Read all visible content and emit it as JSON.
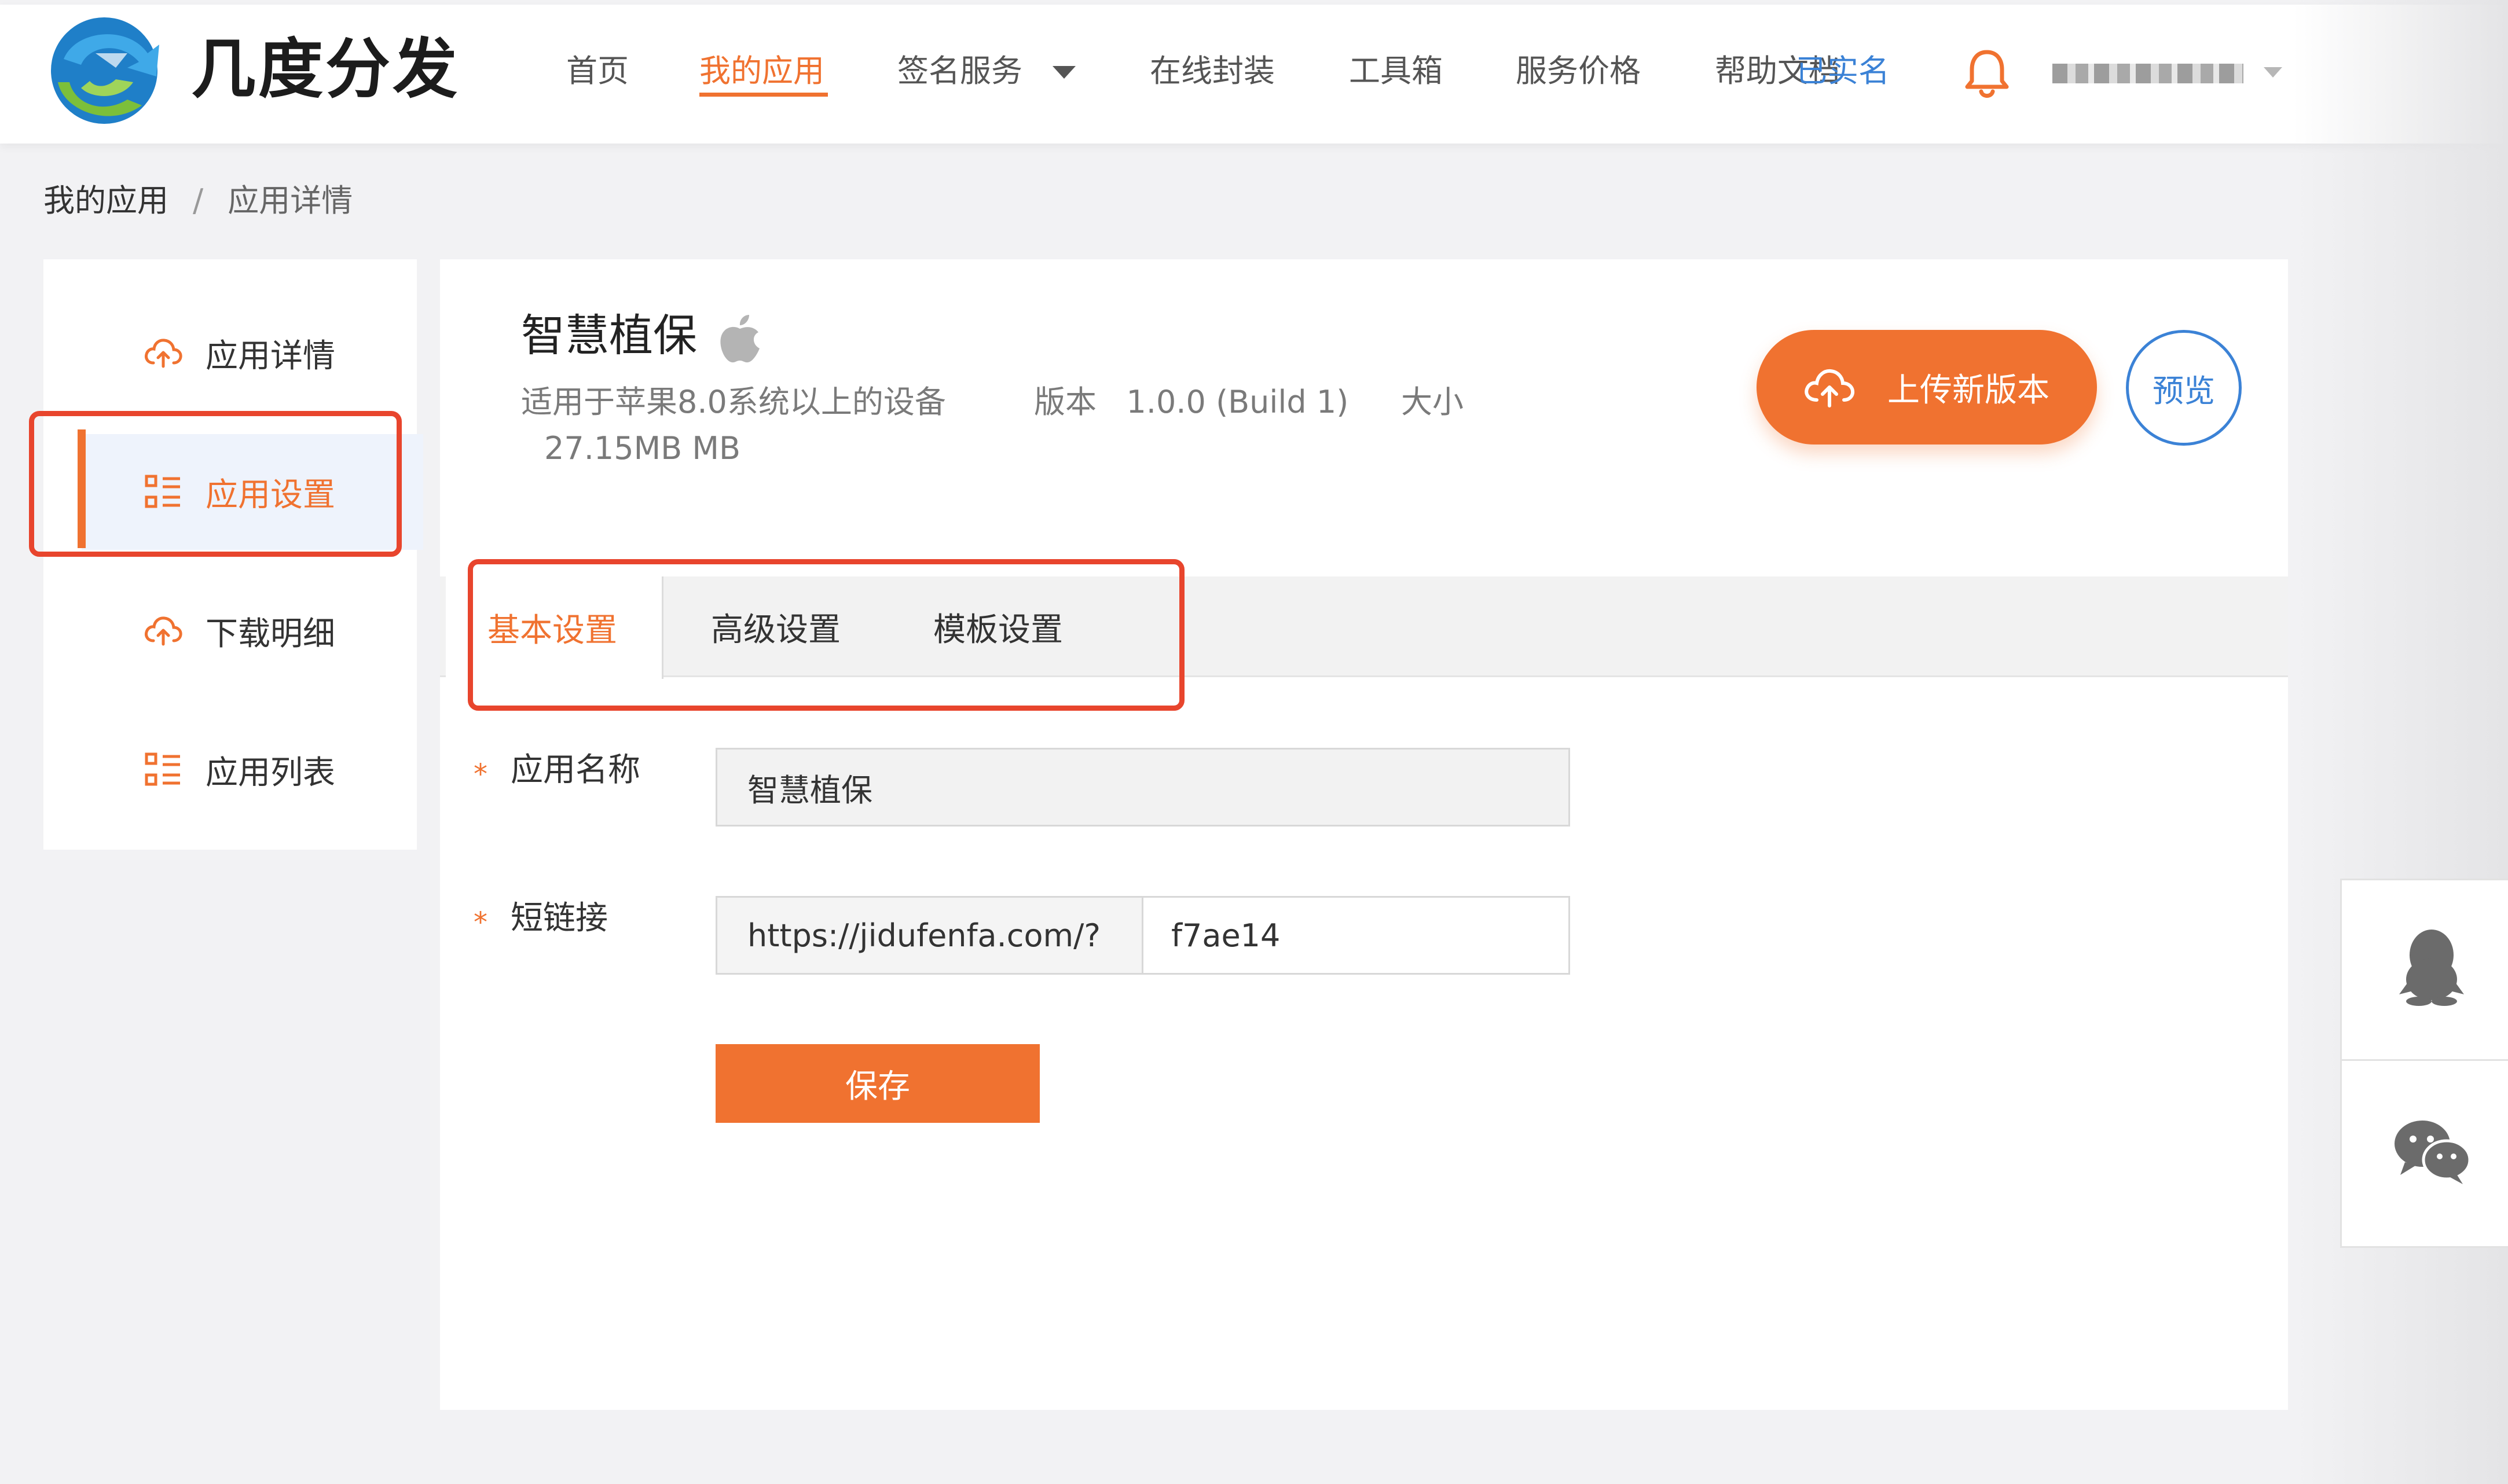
{
  "brand": {
    "name": "几度分发",
    "logo_icon": "jidu-logo-icon"
  },
  "nav": {
    "items": [
      {
        "label": "首页"
      },
      {
        "label": "我的应用",
        "active": true
      },
      {
        "label": "签名服务",
        "has_dropdown": true
      },
      {
        "label": "在线封装"
      },
      {
        "label": "工具箱"
      },
      {
        "label": "服务价格"
      },
      {
        "label": "帮助文档"
      }
    ],
    "realname_link": "已实名",
    "notification_icon": "bell-icon",
    "user_menu_icon": "caret-down-icon"
  },
  "breadcrumb": {
    "root": "我的应用",
    "separator": "/",
    "current": "应用详情"
  },
  "sidebar": {
    "items": [
      {
        "label": "应用详情",
        "icon": "cloud-upload-icon"
      },
      {
        "label": "应用设置",
        "icon": "list-icon",
        "active": true
      },
      {
        "label": "下载明细",
        "icon": "cloud-upload-icon"
      },
      {
        "label": "应用列表",
        "icon": "list-icon"
      }
    ]
  },
  "app": {
    "name": "智慧植保",
    "platform_icon": "apple-icon",
    "device_requirement": "适用于苹果8.0系统以上的设备",
    "version_label": "版本",
    "version": "1.0.0 (Build 1)",
    "size_label": "大小",
    "size": "27.15MB MB"
  },
  "actions": {
    "upload_label": "上传新版本",
    "upload_icon": "cloud-upload-icon",
    "preview_label": "预览"
  },
  "tabs": [
    {
      "label": "基本设置",
      "active": true
    },
    {
      "label": "高级设置"
    },
    {
      "label": "模板设置"
    }
  ],
  "form": {
    "required_mark": "*",
    "name_label": "应用名称",
    "name_value": "智慧植保",
    "link_label": "短链接",
    "link_prefix": "https://jidufenfa.com/?",
    "link_code": "f7ae14",
    "save_label": "保存"
  },
  "floating": {
    "qq_icon": "qq-penguin-icon",
    "wechat_icon": "wechat-icon"
  },
  "colors": {
    "accent": "#f07230",
    "link": "#3b82d6",
    "highlight_border": "#e8452d",
    "sidebar_active_bg": "#eef3fc"
  }
}
